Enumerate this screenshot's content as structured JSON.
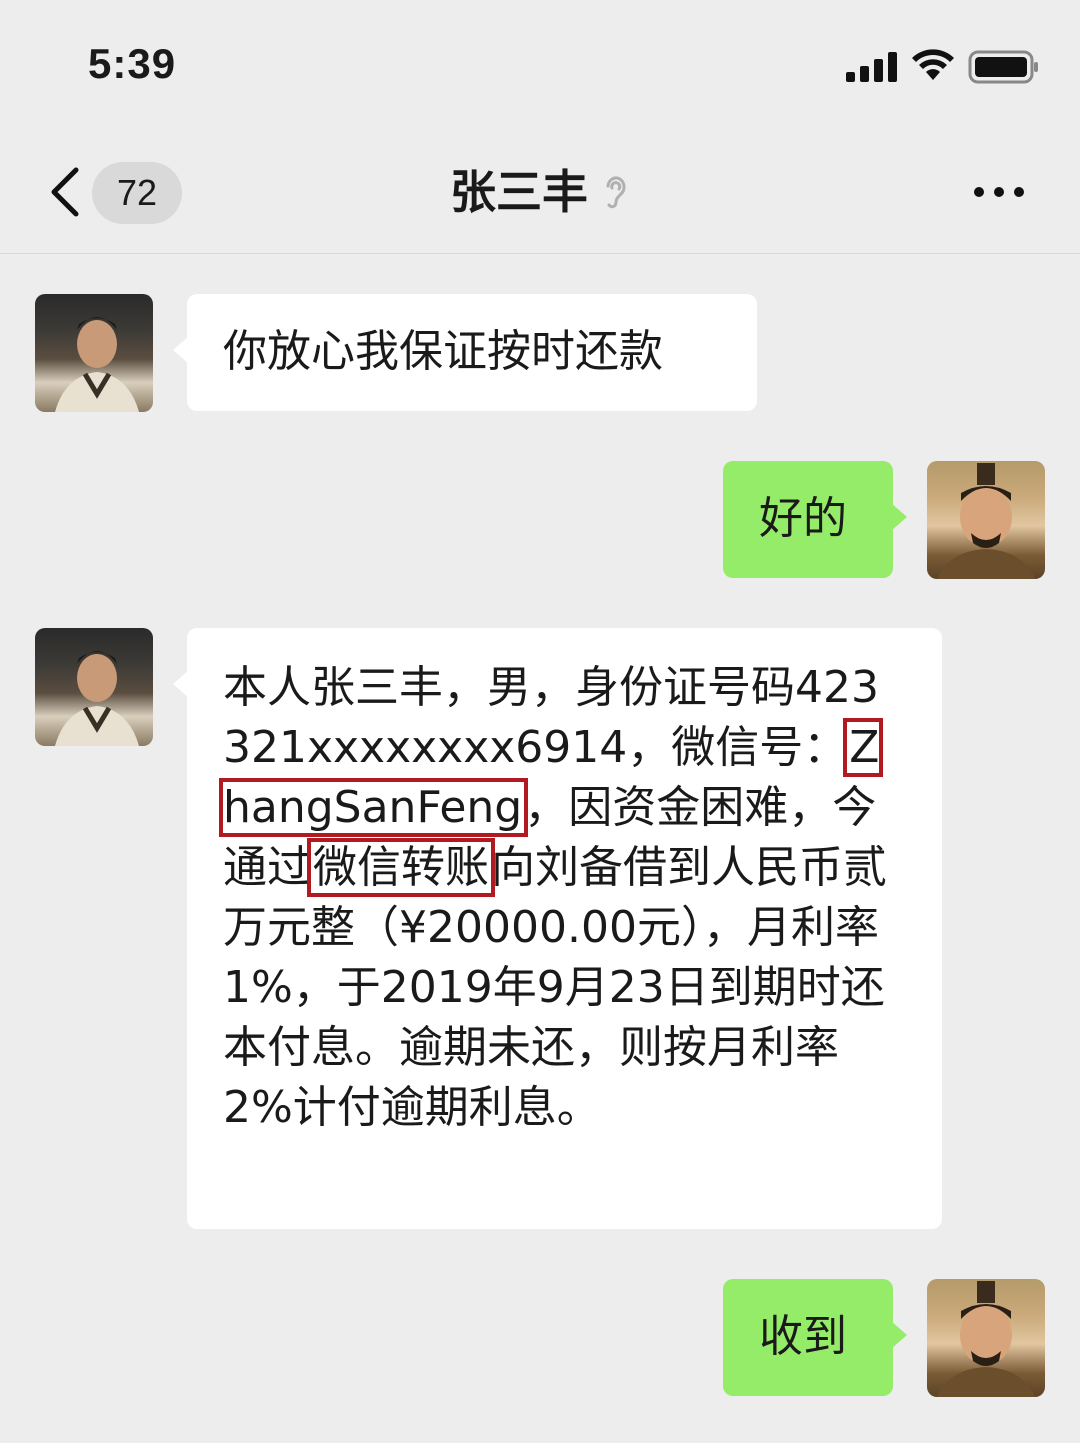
{
  "status_bar": {
    "time": "5:39"
  },
  "nav": {
    "unread_count": "72",
    "title": "张三丰"
  },
  "messages": [
    {
      "sender": "张三丰",
      "direction": "incoming",
      "text": "你放心我保证按时还款"
    },
    {
      "sender": "me",
      "direction": "outgoing",
      "text": "好的"
    },
    {
      "sender": "张三丰",
      "direction": "incoming",
      "parts": {
        "p1": "本人张三丰，男，身份证号码423321xxxxxxxx6914，微信号：",
        "hl1": "ZhangSanFeng",
        "p2": "，因资金困难，今通过",
        "hl2": "微信转账",
        "p3": "向刘备借到人民币贰万元整（¥20000.00元），月利率1%，于2019年9月23日到期时还本付息。逾期未还，则按月利率2%计付逾期利息。"
      }
    },
    {
      "sender": "me",
      "direction": "outgoing",
      "text": "收到"
    }
  ],
  "colors": {
    "background": "#ededed",
    "outgoing_bubble": "#95ec69",
    "incoming_bubble": "#ffffff",
    "highlight_box": "#b21a22"
  }
}
